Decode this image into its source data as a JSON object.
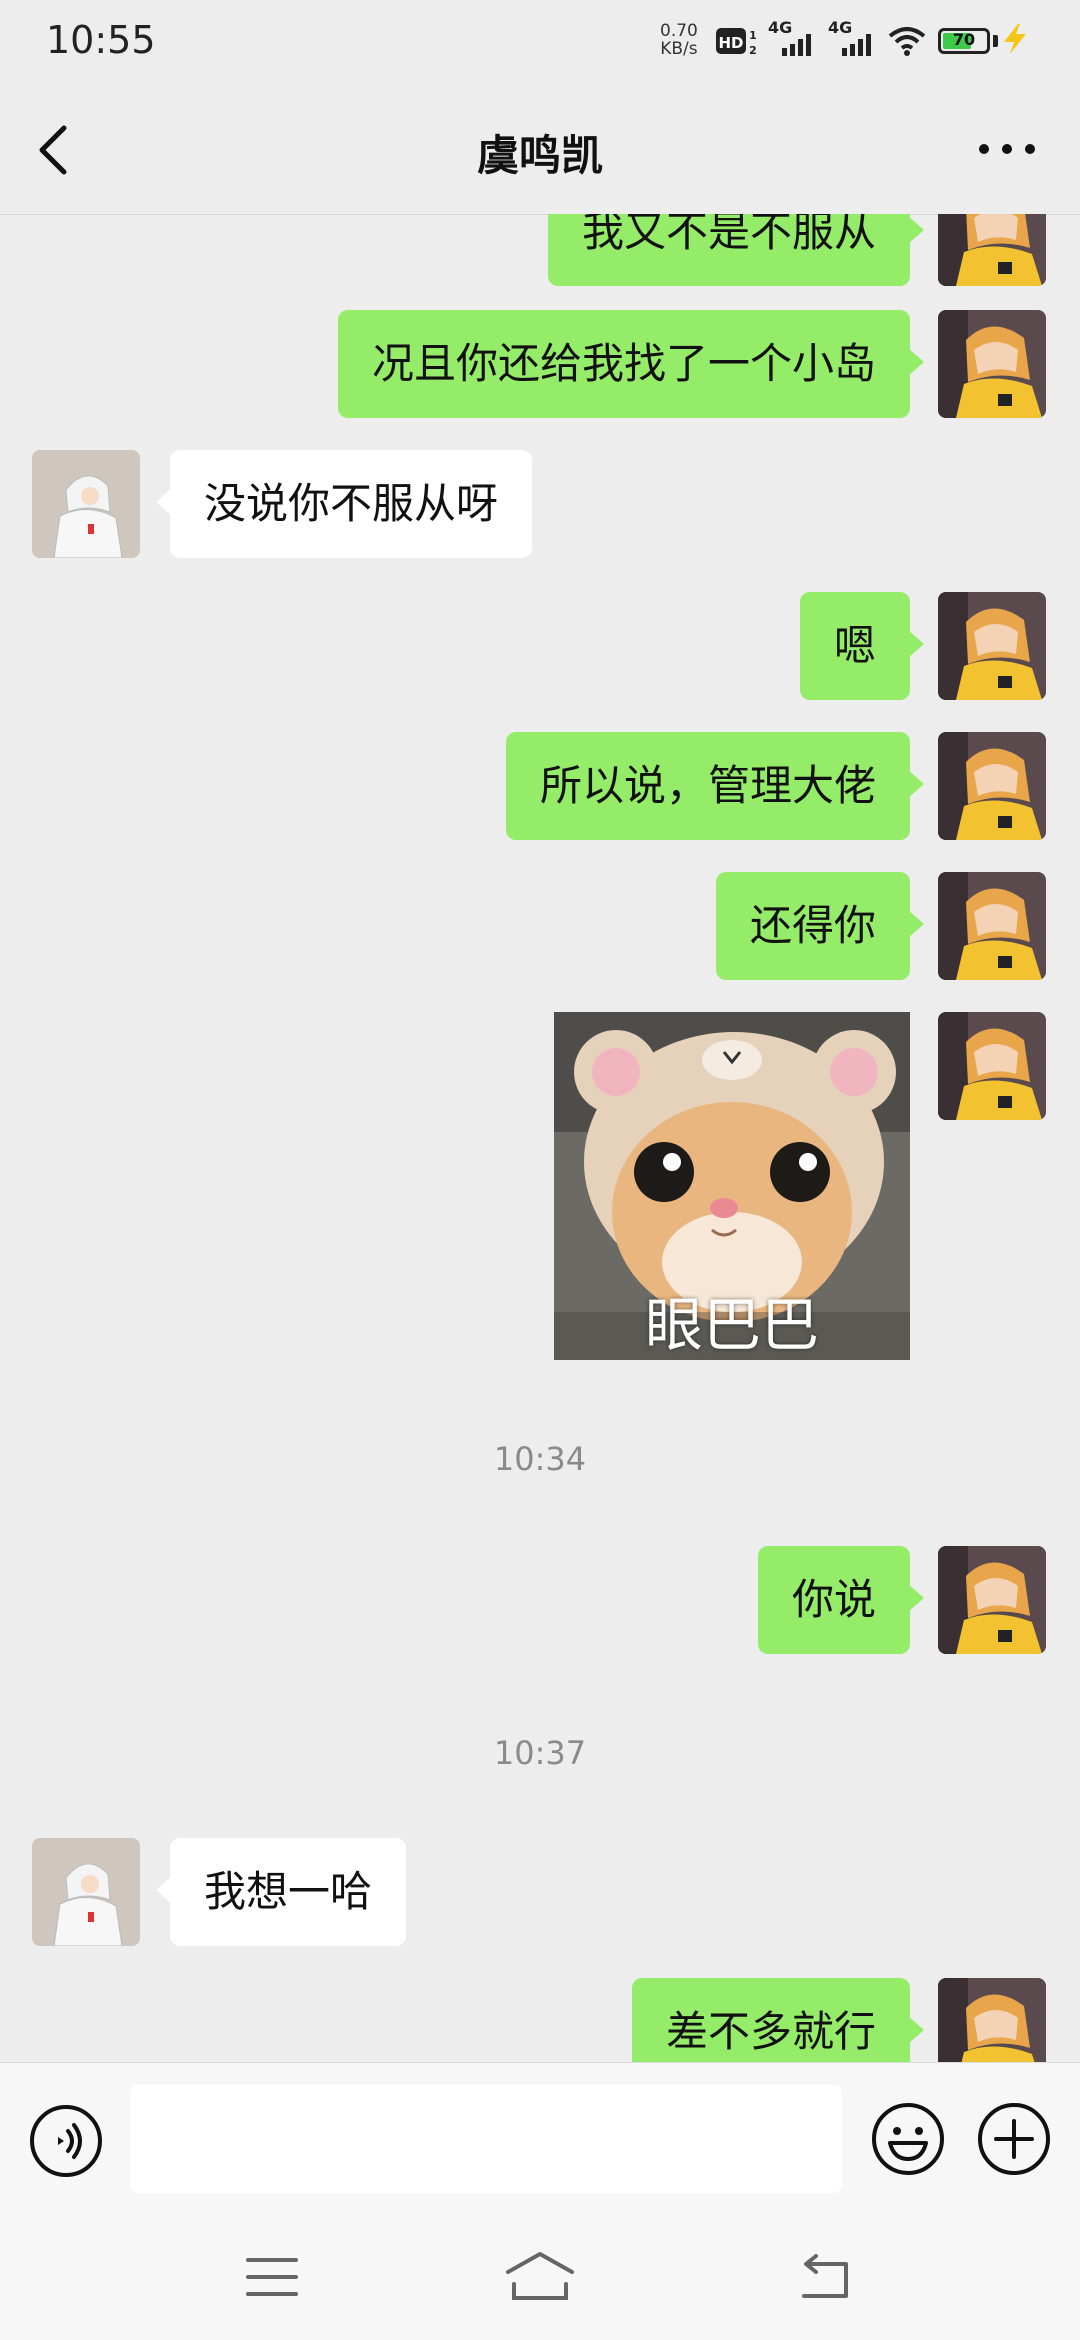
{
  "status_bar": {
    "time": "10:55",
    "net_speed": "0.70",
    "net_speed_unit": "KB/s",
    "hd_label": "HD",
    "signal_1_label": "4G",
    "signal_2_label": "4G",
    "battery_level": "70",
    "battery_fraction": 0.7
  },
  "header": {
    "title": "虞鸣凯",
    "back_icon": "chevron-left-icon",
    "more_icon": "more-dots-icon"
  },
  "messages": [
    {
      "from": "me",
      "type": "text",
      "text": "我又不是不服从"
    },
    {
      "from": "me",
      "type": "text",
      "text": "况且你还给我找了一个小岛"
    },
    {
      "from": "other",
      "type": "text",
      "text": "没说你不服从呀"
    },
    {
      "from": "me",
      "type": "text",
      "text": "嗯"
    },
    {
      "from": "me",
      "type": "text",
      "text": "所以说，管理大佬"
    },
    {
      "from": "me",
      "type": "text",
      "text": "还得你"
    },
    {
      "from": "me",
      "type": "sticker",
      "caption": "眼巴巴"
    },
    {
      "type": "timestamp",
      "text": "10:34"
    },
    {
      "from": "me",
      "type": "text",
      "text": "你说"
    },
    {
      "type": "timestamp",
      "text": "10:37"
    },
    {
      "from": "other",
      "type": "text",
      "text": "我想一哈"
    },
    {
      "from": "me",
      "type": "text",
      "text": "差不多就行"
    }
  ],
  "input_bar": {
    "voice_icon": "voice-icon",
    "input_value": "",
    "emoji_icon": "emoji-icon",
    "plus_icon": "plus-icon"
  },
  "nav_bar": {
    "menu_icon": "menu-icon",
    "home_icon": "home-icon",
    "back_icon": "back-icon"
  },
  "colors": {
    "background": "#ededed",
    "my_bubble": "#95ec69",
    "their_bubble": "#ffffff",
    "timestamp": "#8a8a8a",
    "battery": "#3fc94a",
    "charging": "#f5c518"
  }
}
